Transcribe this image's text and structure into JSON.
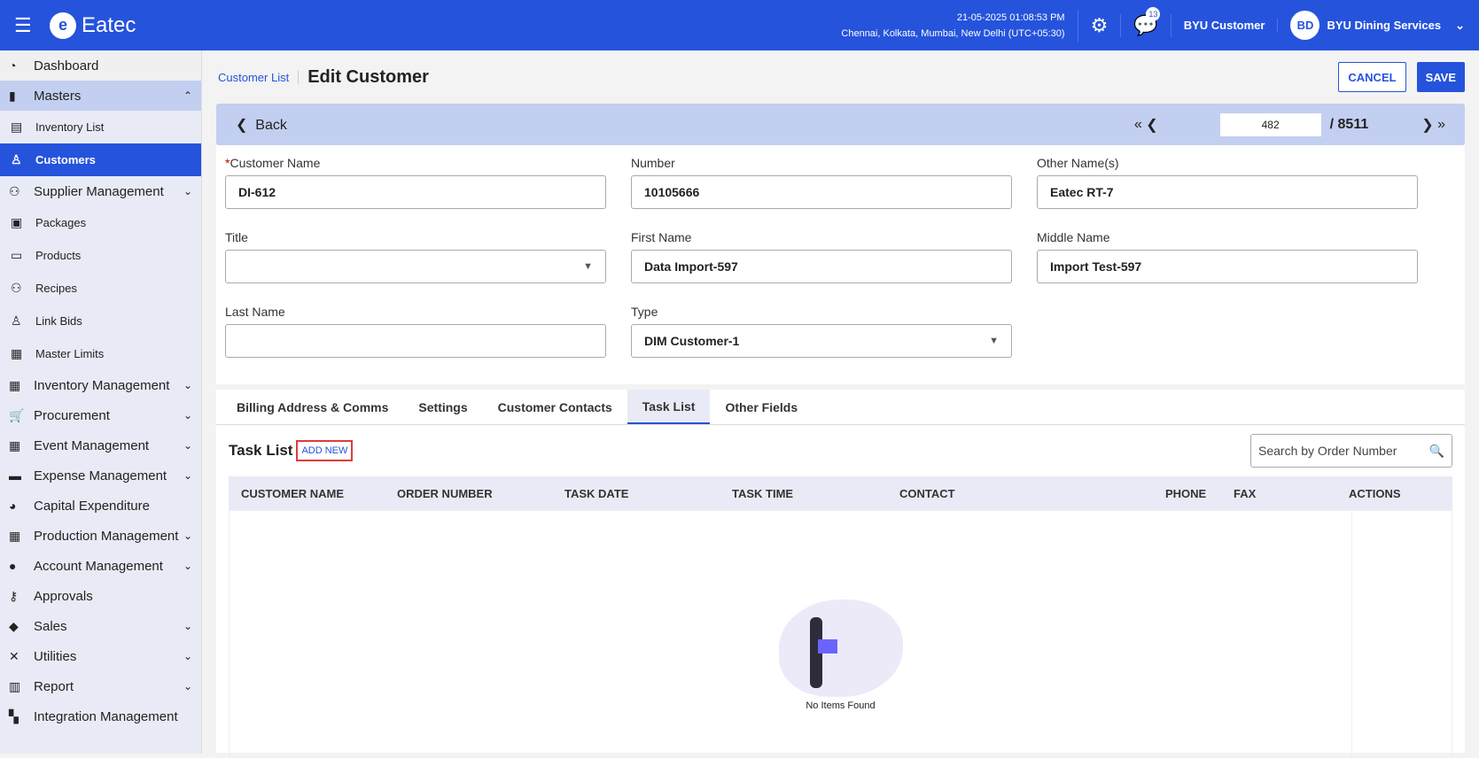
{
  "header": {
    "app_name": "Eatec",
    "datetime": "21-05-2025 01:08:53 PM",
    "timezone": "Chennai, Kolkata, Mumbai, New Delhi (UTC+05:30)",
    "notif_count": "13",
    "user": "BYU Customer",
    "avatar": "BD",
    "org": "BYU Dining Services"
  },
  "sidebar": {
    "items": [
      {
        "label": "Dashboard",
        "icon": "◔"
      },
      {
        "label": "Masters",
        "icon": "▮"
      },
      {
        "label": "Inventory List",
        "icon": "▤"
      },
      {
        "label": "Customers",
        "icon": "♙"
      },
      {
        "label": "Supplier Management",
        "icon": "⚇"
      },
      {
        "label": "Packages",
        "icon": "▣"
      },
      {
        "label": "Products",
        "icon": "▭"
      },
      {
        "label": "Recipes",
        "icon": "⚇"
      },
      {
        "label": "Link Bids",
        "icon": "♙"
      },
      {
        "label": "Master Limits",
        "icon": "▦"
      },
      {
        "label": "Inventory Management",
        "icon": "▦"
      },
      {
        "label": "Procurement",
        "icon": "🛒"
      },
      {
        "label": "Event Management",
        "icon": "▦"
      },
      {
        "label": "Expense Management",
        "icon": "▬"
      },
      {
        "label": "Capital Expenditure",
        "icon": "◕"
      },
      {
        "label": "Production Management",
        "icon": "▦"
      },
      {
        "label": "Account Management",
        "icon": "●"
      },
      {
        "label": "Approvals",
        "icon": "⚷"
      },
      {
        "label": "Sales",
        "icon": "◆"
      },
      {
        "label": "Utilities",
        "icon": "✕"
      },
      {
        "label": "Report",
        "icon": "▥"
      },
      {
        "label": "Integration Management",
        "icon": "▚"
      }
    ]
  },
  "page": {
    "breadcrumb": "Customer List",
    "title": "Edit Customer",
    "cancel": "CANCEL",
    "save": "SAVE",
    "back": "Back",
    "record": "482",
    "total": "/ 8511"
  },
  "form": {
    "customer_name_label": "Customer Name",
    "customer_name": "DI-612",
    "number_label": "Number",
    "number": "10105666",
    "other_names_label": "Other Name(s)",
    "other_names": "Eatec RT-7",
    "title_label": "Title",
    "title": "",
    "first_name_label": "First Name",
    "first_name": "Data Import-597",
    "middle_name_label": "Middle Name",
    "middle_name": "Import Test-597",
    "last_name_label": "Last Name",
    "last_name": "",
    "type_label": "Type",
    "type": "DIM Customer-1"
  },
  "tabs": [
    "Billing Address & Comms",
    "Settings",
    "Customer Contacts",
    "Task List",
    "Other Fields"
  ],
  "tasklist": {
    "title": "Task List",
    "add_new": "ADD NEW",
    "search_placeholder": "Search by Order Number",
    "columns": [
      "CUSTOMER NAME",
      "ORDER NUMBER",
      "TASK DATE",
      "TASK TIME",
      "CONTACT",
      "PHONE",
      "FAX",
      "ACTIONS"
    ],
    "empty": "No Items Found"
  }
}
